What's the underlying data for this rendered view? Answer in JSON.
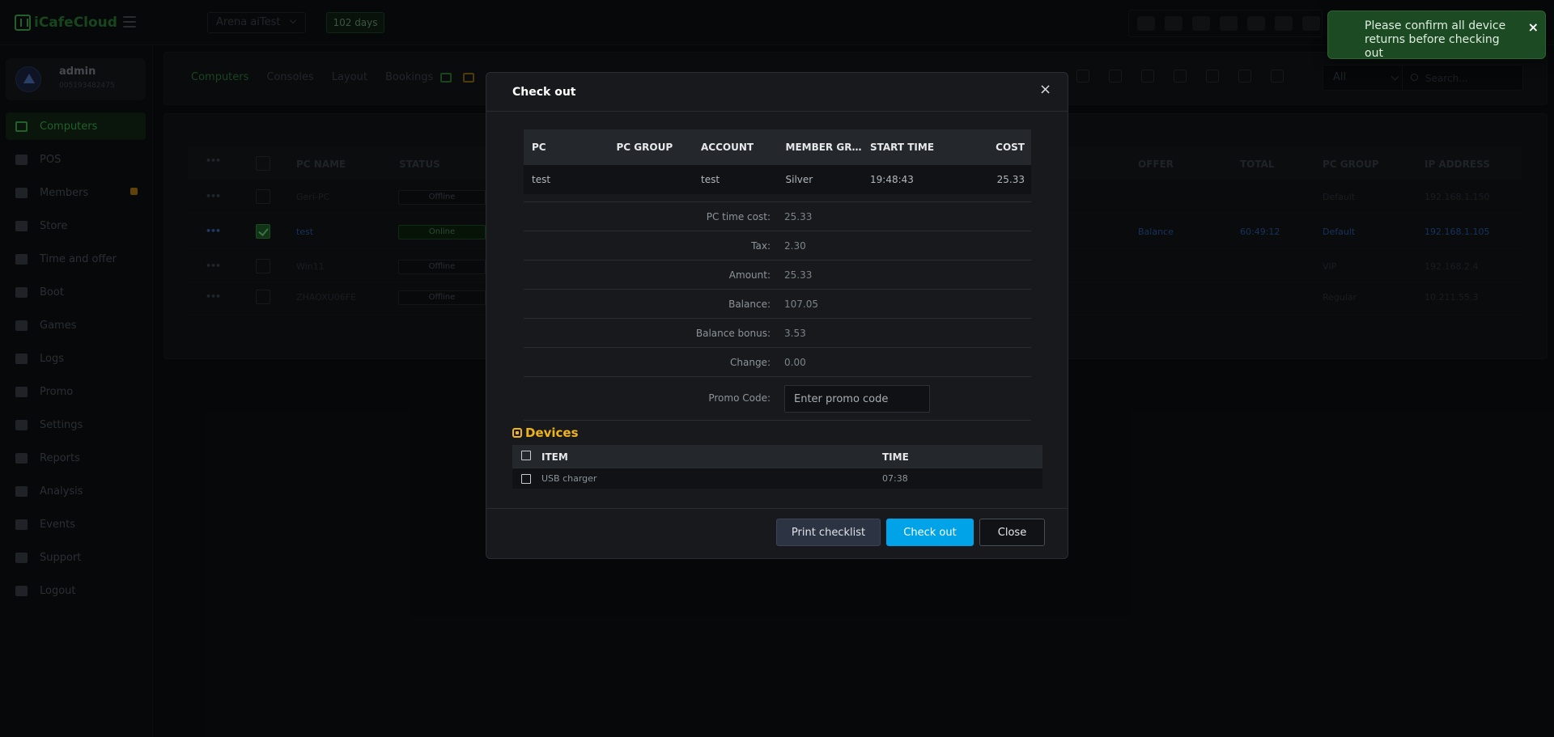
{
  "app": {
    "name": "iCafeCloud"
  },
  "header": {
    "cafe_name": "Arena aiTest",
    "days_badge": "102 days"
  },
  "toast": {
    "message": "Please confirm all device returns before checking out",
    "close": "×"
  },
  "sidebar": {
    "profile": {
      "name": "admin",
      "id": "005193482475"
    },
    "items": [
      {
        "label": "Computers",
        "icon": "monitor-icon",
        "active": true
      },
      {
        "label": "POS",
        "icon": "pos-icon"
      },
      {
        "label": "Members",
        "icon": "members-icon"
      },
      {
        "label": "Store",
        "icon": "store-icon"
      },
      {
        "label": "Time and offer",
        "icon": "clock-icon"
      },
      {
        "label": "Boot",
        "icon": "boot-icon"
      },
      {
        "label": "Games",
        "icon": "gamepad-icon"
      },
      {
        "label": "Logs",
        "icon": "logs-icon"
      },
      {
        "label": "Promo",
        "icon": "tag-icon"
      },
      {
        "label": "Settings",
        "icon": "gear-icon"
      },
      {
        "label": "Reports",
        "icon": "reports-icon"
      },
      {
        "label": "Analysis",
        "icon": "analysis-icon"
      },
      {
        "label": "Events",
        "icon": "crown-icon"
      },
      {
        "label": "Support",
        "icon": "phone-icon"
      },
      {
        "label": "Logout",
        "icon": "logout-icon"
      }
    ]
  },
  "toolbar": {
    "tabs": [
      "Computers",
      "Consoles",
      "Layout",
      "Bookings"
    ],
    "filter_value": "All",
    "search_placeholder": "Search..."
  },
  "grid": {
    "columns": [
      "PC NAME",
      "STATUS",
      "OFFER",
      "TOTAL",
      "PC GROUP",
      "IP ADDRESS"
    ],
    "rows": [
      {
        "name": "Geri-PC",
        "status": "Offline",
        "offer": "",
        "total": "",
        "group": "Default",
        "ip": "192.168.1.150"
      },
      {
        "name": "test",
        "status": "Online",
        "offer": "Balance",
        "total": "60:49:12",
        "group": "Default",
        "ip": "192.168.1.105"
      },
      {
        "name": "Win11",
        "status": "Offline",
        "offer": "",
        "total": "",
        "group": "VIP",
        "ip": "192.168.2.4"
      },
      {
        "name": "ZHAOXU06FE",
        "status": "Offline",
        "offer": "",
        "total": "",
        "group": "Regular",
        "ip": "10.211.55.3"
      }
    ]
  },
  "modal": {
    "title": "Check out",
    "close": "×",
    "summary": {
      "headers": [
        "PC",
        "PC GROUP",
        "ACCOUNT",
        "MEMBER GROUP",
        "START TIME",
        "COST"
      ],
      "row": {
        "pc": "test",
        "pc_group": "",
        "account": "test",
        "member_group": "Silver",
        "start_time": "19:48:43",
        "cost": "25.33"
      }
    },
    "details": {
      "pc_time_cost": {
        "label": "PC time cost:",
        "value": "25.33"
      },
      "tax": {
        "label": "Tax:",
        "value": "2.30"
      },
      "amount": {
        "label": "Amount:",
        "value": "25.33"
      },
      "balance": {
        "label": "Balance:",
        "value": "107.05"
      },
      "balance_bonus": {
        "label": "Balance bonus:",
        "value": "3.53"
      },
      "change": {
        "label": "Change:",
        "value": "0.00"
      },
      "promo": {
        "label": "Promo Code:",
        "placeholder": "Enter promo code"
      }
    },
    "devices": {
      "title": "Devices",
      "headers": {
        "item": "ITEM",
        "time": "TIME"
      },
      "rows": [
        {
          "item": "USB charger",
          "time": "07:38"
        }
      ]
    },
    "buttons": {
      "print": "Print checklist",
      "checkout": "Check out",
      "close": "Close"
    }
  },
  "colors": {
    "accent_green": "#3fae4d",
    "primary_button": "#00a3e8",
    "devices_title": "#f0b418",
    "toast_bg": "#1c4a22"
  }
}
